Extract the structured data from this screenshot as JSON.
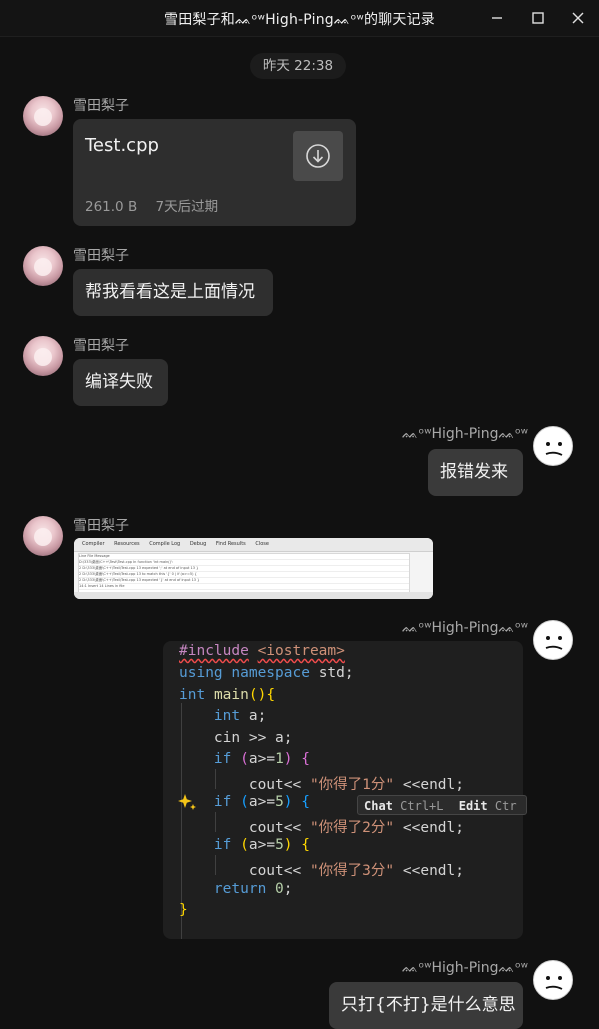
{
  "window": {
    "title": "雪田梨子和ᨐᵒʷHigh-Pingᨐᵒʷ的聊天记录",
    "controls": [
      "minimize-icon",
      "maximize-icon",
      "close-icon"
    ]
  },
  "timestamp": "昨天 22:38",
  "contacts": {
    "other_name": "雪田梨子",
    "me_name": "ᨐᵒʷHigh-Pingᨐᵒʷ"
  },
  "messages": {
    "file": {
      "name": "Test.cpp",
      "size": "261.0 B",
      "expiry": "7天后过期",
      "icon": "download-icon"
    },
    "m2": "帮我看看这是上面情况",
    "m3": "编译失败",
    "m4": "报错发来",
    "screenshot": {
      "tabs": [
        "Compiler",
        "Resources",
        "Compile Log",
        "Debug",
        "Find Results",
        "Close"
      ],
      "rows": [
        "Line   File                                          Message",
        "       D:\\333\\桌面\\C++\\Test\\Test.cpp            In function 'int main()':",
        "2      D:\\333\\桌面\\C++\\Test\\Test.cpp  13        expected ';' at end of input 13 }",
        "2      D:\\333\\桌面\\C++\\Test\\Test.cpp  13        to match this '{'  0 |    if (a>=5) {",
        "2      D:\\333\\桌面\\C++\\Test\\Test.cpp  13        expected '}' at end of input 13 }",
        "14:1          Insert         14 Lines in file"
      ]
    },
    "code": [
      "#include <iostream>",
      "using namespace std;",
      "int main(){",
      "    int a;",
      "    cin >> a;",
      "    if (a>=1) {",
      "        cout<< \"你得了1分\" <<endl;",
      "    if (a>=5) {",
      "        cout<< \"你得了2分\" <<endl;",
      "    if (a>=5) {",
      "        cout<< \"你得了3分\" <<endl;",
      "    return 0;",
      "}"
    ],
    "code_hint": {
      "chat_label": "Chat",
      "chat_key": "Ctrl+L",
      "edit_label": "Edit",
      "edit_key": "Ctr"
    },
    "m7": "只打{不打}是什么意思"
  }
}
